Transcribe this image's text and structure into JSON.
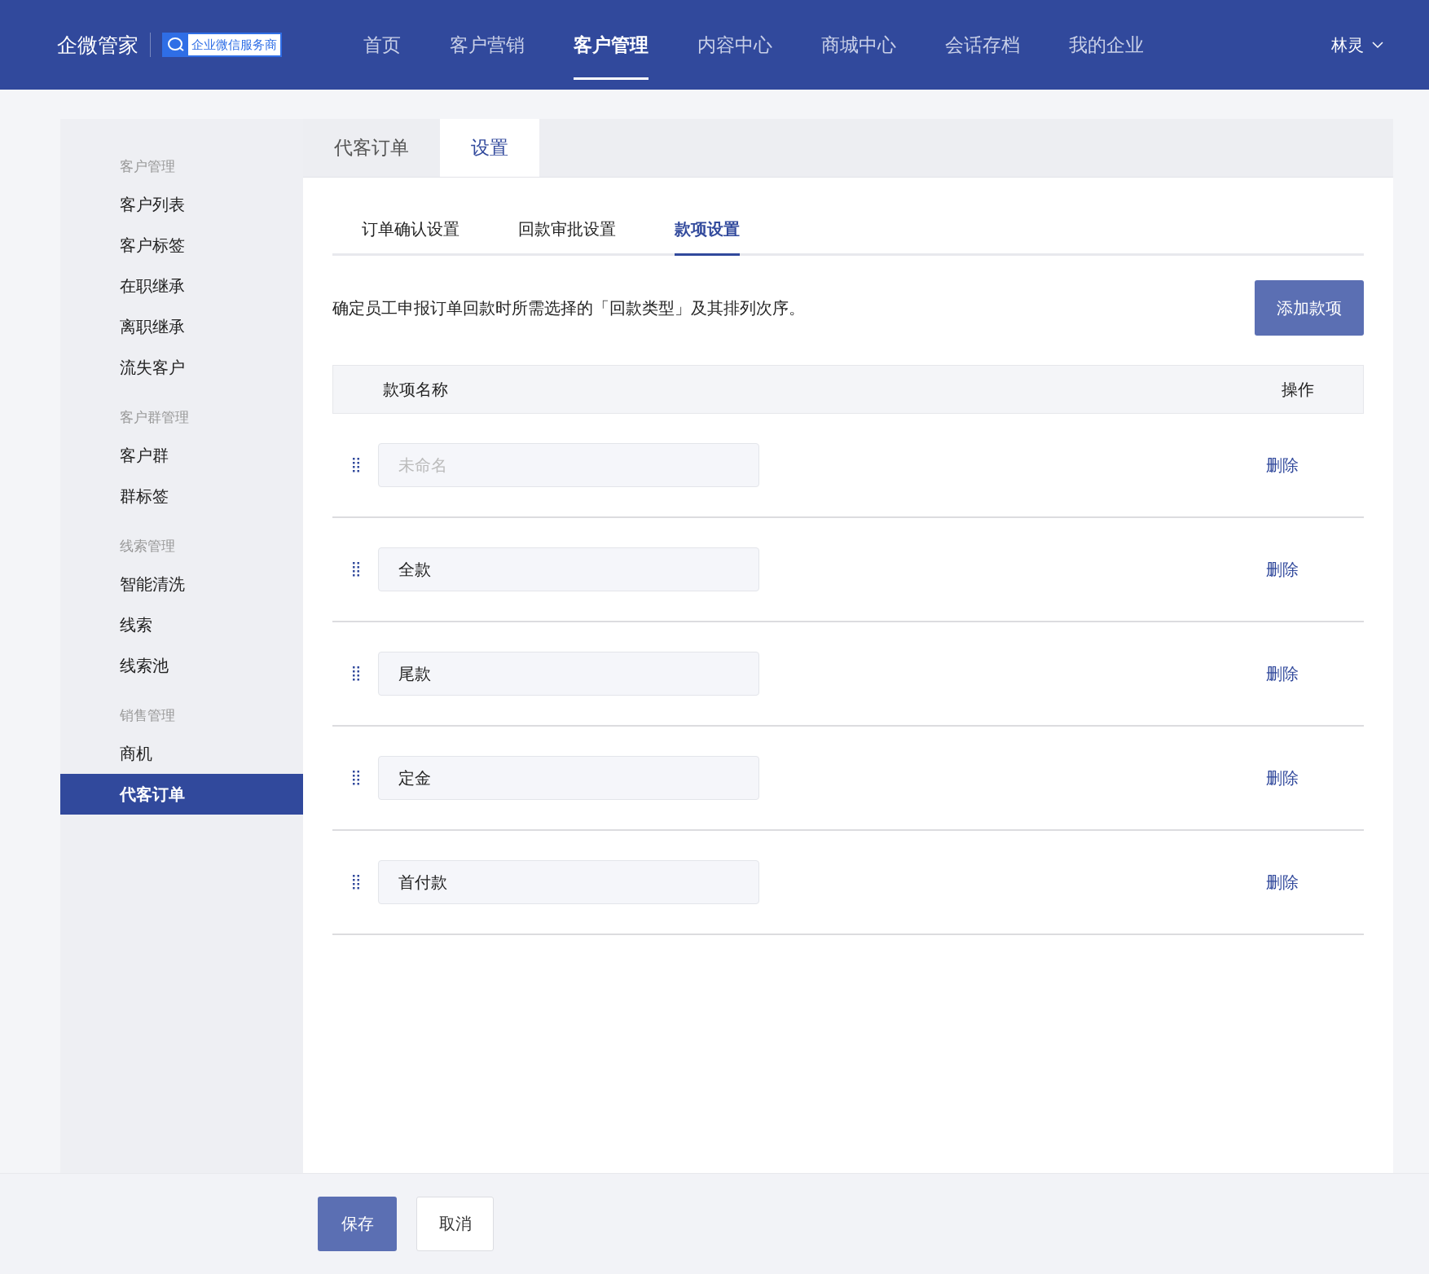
{
  "header": {
    "brand": "企微管家",
    "badge": "企业微信服务商",
    "nav": [
      {
        "label": "首页",
        "selected": false
      },
      {
        "label": "客户营销",
        "selected": false
      },
      {
        "label": "客户管理",
        "selected": true
      },
      {
        "label": "内容中心",
        "selected": false
      },
      {
        "label": "商城中心",
        "selected": false
      },
      {
        "label": "会话存档",
        "selected": false
      },
      {
        "label": "我的企业",
        "selected": false
      }
    ],
    "user": "林灵"
  },
  "sidebar": {
    "groups": [
      {
        "title": "客户管理",
        "items": [
          {
            "label": "客户列表",
            "selected": false
          },
          {
            "label": "客户标签",
            "selected": false
          },
          {
            "label": "在职继承",
            "selected": false
          },
          {
            "label": "离职继承",
            "selected": false
          },
          {
            "label": "流失客户",
            "selected": false
          }
        ]
      },
      {
        "title": "客户群管理",
        "items": [
          {
            "label": "客户群",
            "selected": false
          },
          {
            "label": "群标签",
            "selected": false
          }
        ]
      },
      {
        "title": "线索管理",
        "items": [
          {
            "label": "智能清洗",
            "selected": false
          },
          {
            "label": "线索",
            "selected": false
          },
          {
            "label": "线索池",
            "selected": false
          }
        ]
      },
      {
        "title": "销售管理",
        "items": [
          {
            "label": "商机",
            "selected": false
          },
          {
            "label": "代客订单",
            "selected": true
          }
        ]
      }
    ]
  },
  "tabs": [
    {
      "label": "代客订单",
      "selected": false
    },
    {
      "label": "设置",
      "selected": true
    }
  ],
  "subtabs": [
    {
      "label": "订单确认设置",
      "selected": false
    },
    {
      "label": "回款审批设置",
      "selected": false
    },
    {
      "label": "款项设置",
      "selected": true
    }
  ],
  "description": "确定员工申报订单回款时所需选择的「回款类型」及其排列次序。",
  "add_button": "添加款项",
  "table": {
    "columns": [
      "款项名称",
      "操作"
    ],
    "rows": [
      {
        "placeholder": "未命名",
        "action": "删除"
      },
      {
        "value": "全款",
        "action": "删除"
      },
      {
        "value": "尾款",
        "action": "删除"
      },
      {
        "value": "定金",
        "action": "删除"
      },
      {
        "value": "首付款",
        "action": "删除"
      }
    ]
  },
  "footer": {
    "buttons": [
      {
        "label": "保存",
        "kind": "primary"
      },
      {
        "label": "取消",
        "kind": "default"
      }
    ]
  }
}
